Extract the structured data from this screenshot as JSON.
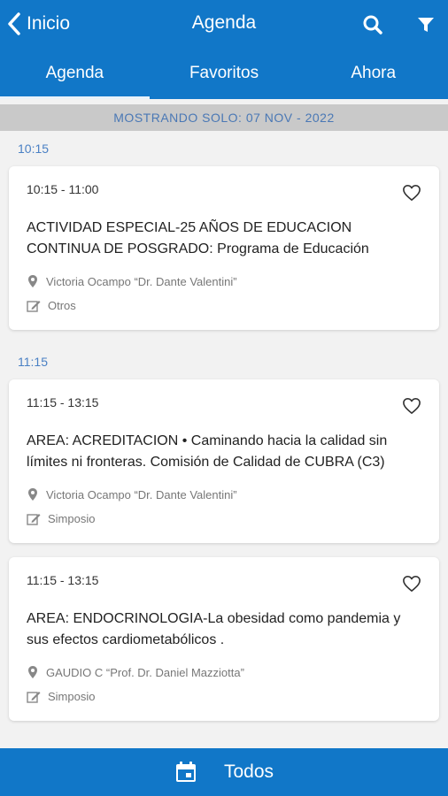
{
  "header": {
    "back_label": "Inicio",
    "title": "Agenda"
  },
  "tabs": [
    {
      "label": "Agenda"
    },
    {
      "label": "Favoritos"
    },
    {
      "label": "Ahora"
    }
  ],
  "banner": "MOSTRANDO SOLO: 07 NOV - 2022",
  "groups": [
    {
      "time": "10:15",
      "sessions": [
        {
          "range": "10:15 - 11:00",
          "title": "ACTIVIDAD ESPECIAL-25 AÑOS DE EDUCACION CONTINUA DE POSGRADO: Programa de Educación",
          "location": "Victoria Ocampo “Dr. Dante Valentini”",
          "category": "Otros"
        }
      ]
    },
    {
      "time": "11:15",
      "sessions": [
        {
          "range": "11:15 - 13:15",
          "title": "AREA: ACREDITACION • Caminando hacia la calidad sin límites ni fronteras. Comisión de Calidad de CUBRA (C3)",
          "location": "Victoria Ocampo “Dr. Dante Valentini”",
          "category": "Simposio"
        },
        {
          "range": "11:15 - 13:15",
          "title": "AREA: ENDOCRINOLOGIA-La obesidad como pandemia y sus efectos cardiometabólicos .",
          "location": "GAUDIO C “Prof. Dr. Daniel Mazziotta”",
          "category": "Simposio"
        }
      ]
    }
  ],
  "bottom": {
    "label": "Todos",
    "icon": "calendar-icon"
  },
  "colors": {
    "primary": "#1177c8",
    "banner_bg": "#c9c9c9",
    "banner_text": "#4a78b5",
    "time_header": "#4a80c4"
  }
}
